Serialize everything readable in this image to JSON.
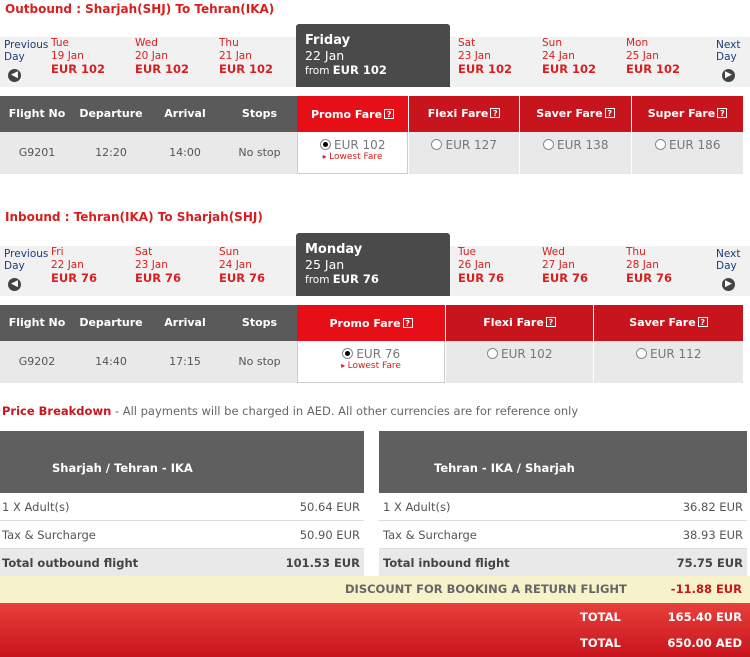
{
  "outbound": {
    "label": "Outbound",
    "route": ": Sharjah(SHJ) To Tehran(IKA)",
    "prev_label": [
      "Previous",
      "Day"
    ],
    "next_label": [
      "Next",
      "Day"
    ],
    "dates_before": [
      {
        "day": "Tue",
        "date": "19 Jan",
        "price": "EUR 102"
      },
      {
        "day": "Wed",
        "date": "20 Jan",
        "price": "EUR 102"
      },
      {
        "day": "Thu",
        "date": "21 Jan",
        "price": "EUR 102"
      }
    ],
    "selected": {
      "day": "Friday",
      "date": "22 Jan",
      "from": "from",
      "price": "EUR 102"
    },
    "dates_after": [
      {
        "day": "Sat",
        "date": "23 Jan",
        "price": "EUR 102"
      },
      {
        "day": "Sun",
        "date": "24 Jan",
        "price": "EUR 102"
      },
      {
        "day": "Mon",
        "date": "25 Jan",
        "price": "EUR 102"
      }
    ],
    "columns": [
      "Flight No",
      "Departure",
      "Arrival",
      "Stops"
    ],
    "flight": {
      "no": "G9201",
      "departure": "12:20",
      "arrival": "14:00",
      "stops": "No stop"
    },
    "fares": [
      {
        "name": "Promo Fare",
        "price": "EUR 102",
        "selected": true,
        "note": "Lowest Fare"
      },
      {
        "name": "Flexi Fare",
        "price": "EUR 127",
        "selected": false
      },
      {
        "name": "Saver Fare",
        "price": "EUR 138",
        "selected": false
      },
      {
        "name": "Super Fare",
        "price": "EUR 186",
        "selected": false
      }
    ]
  },
  "inbound": {
    "label": "Inbound",
    "route": ": Tehran(IKA) To Sharjah(SHJ)",
    "prev_label": [
      "Previous",
      "Day"
    ],
    "next_label": [
      "Next",
      "Day"
    ],
    "dates_before": [
      {
        "day": "Fri",
        "date": "22 Jan",
        "price": "EUR 76"
      },
      {
        "day": "Sat",
        "date": "23 Jan",
        "price": "EUR 76"
      },
      {
        "day": "Sun",
        "date": "24 Jan",
        "price": "EUR 76"
      }
    ],
    "selected": {
      "day": "Monday",
      "date": "25 Jan",
      "from": "from",
      "price": "EUR 76"
    },
    "dates_after": [
      {
        "day": "Tue",
        "date": "26 Jan",
        "price": "EUR 76"
      },
      {
        "day": "Wed",
        "date": "27 Jan",
        "price": "EUR 76"
      },
      {
        "day": "Thu",
        "date": "28 Jan",
        "price": "EUR 76"
      }
    ],
    "columns": [
      "Flight No",
      "Departure",
      "Arrival",
      "Stops"
    ],
    "flight": {
      "no": "G9202",
      "departure": "14:40",
      "arrival": "17:15",
      "stops": "No stop"
    },
    "fares": [
      {
        "name": "Promo Fare",
        "price": "EUR 76",
        "selected": true,
        "note": "Lowest Fare"
      },
      {
        "name": "Flexi Fare",
        "price": "EUR 102",
        "selected": false
      },
      {
        "name": "Saver Fare",
        "price": "EUR 112",
        "selected": false
      }
    ]
  },
  "price_breakdown": {
    "title": "Price Breakdown",
    "note": " - All payments will be charged in AED. All other currencies are for reference only",
    "outbound": {
      "heading": "Sharjah / Tehran - IKA",
      "rows": [
        {
          "label": "1 X Adult(s)",
          "value": "50.64 EUR"
        },
        {
          "label": "Tax & Surcharge",
          "value": "50.90 EUR"
        }
      ],
      "total_label": "Total outbound flight",
      "total_value": "101.53 EUR"
    },
    "inbound": {
      "heading": "Tehran - IKA / Sharjah",
      "rows": [
        {
          "label": "1 X Adult(s)",
          "value": "36.82 EUR"
        },
        {
          "label": "Tax & Surcharge",
          "value": "38.93 EUR"
        }
      ],
      "total_label": "Total inbound flight",
      "total_value": "75.75 EUR"
    },
    "discount_label": "DISCOUNT FOR BOOKING A RETURN FLIGHT",
    "discount_value": "-11.88 EUR",
    "total_label": "TOTAL",
    "total_eur": "165.40 EUR",
    "total_aed": "650.00 AED"
  },
  "icons": {
    "prev": "chevron-left-icon",
    "next": "chevron-right-icon",
    "help": "question-icon"
  },
  "colors": {
    "accent": "#c8141c",
    "selected_tab": "#4a4a4a"
  }
}
